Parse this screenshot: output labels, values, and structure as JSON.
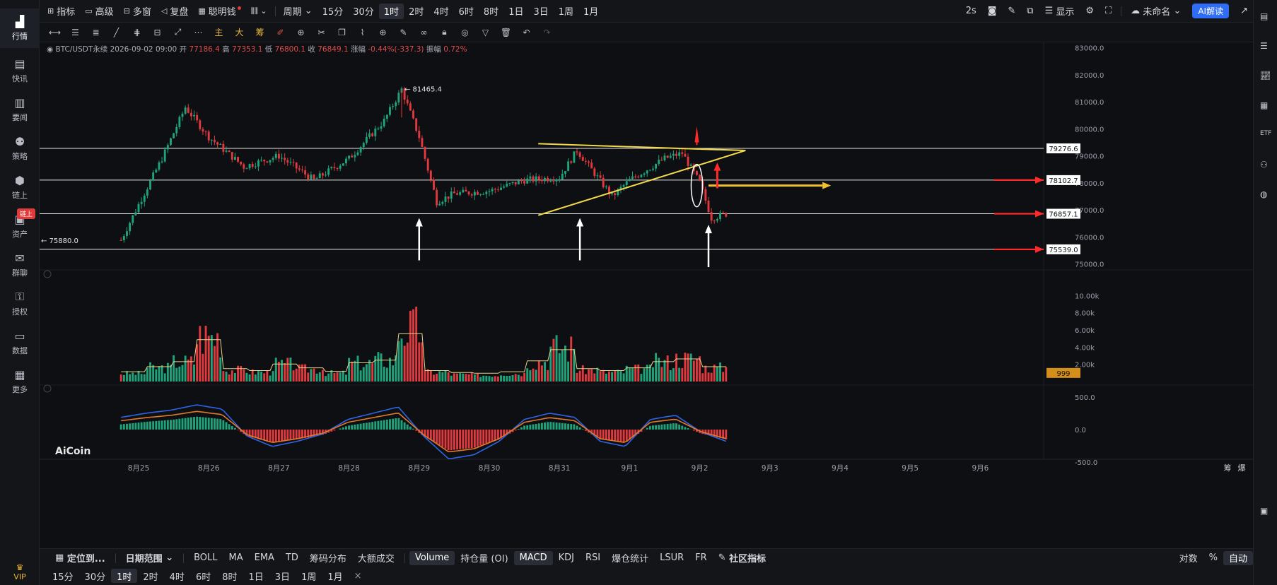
{
  "nav": [
    {
      "label": "行情",
      "icon": "market-icon",
      "active": true
    },
    {
      "label": "快讯",
      "icon": "news-flash-icon"
    },
    {
      "label": "要闻",
      "icon": "headlines-icon"
    },
    {
      "label": "策略",
      "icon": "strategy-robot-icon"
    },
    {
      "label": "链上",
      "icon": "onchain-icon"
    },
    {
      "label": "资产",
      "icon": "wallet-icon",
      "badge": "链上"
    },
    {
      "label": "群聊",
      "icon": "chat-icon"
    },
    {
      "label": "授权",
      "icon": "authorize-icon"
    },
    {
      "label": "数据",
      "icon": "data-monitor-icon"
    },
    {
      "label": "更多",
      "icon": "more-grid-icon"
    }
  ],
  "vip_label": "VIP",
  "topbar": {
    "left": [
      "指标",
      "高级",
      "多窗",
      "复盘",
      "聪明钱"
    ],
    "period_label": "周期",
    "periods": [
      "15分",
      "30分",
      "1时",
      "2时",
      "4时",
      "6时",
      "8时",
      "1日",
      "3日",
      "1周",
      "1月"
    ],
    "active_period": "1时",
    "refresh": "2s",
    "display": "显示",
    "layout_name": "未命名",
    "ai_button": "AI解读"
  },
  "drawbar_text": [
    "主",
    "大",
    "筹"
  ],
  "infobar": {
    "symbol": "BTC/USDT永续",
    "datetime": "2026-09-02 09:00",
    "open_label": "开",
    "open": "77186.4",
    "high_label": "高",
    "high": "77353.1",
    "low_label": "低",
    "low": "76800.1",
    "close_label": "收",
    "close": "76849.1",
    "change_label": "涨幅",
    "change": "-0.44%(-337.3)",
    "amp_label": "振幅",
    "amp": "0.72%"
  },
  "watermark": "AiCoin",
  "price_axis": [
    "83000.0",
    "82000.0",
    "81000.0",
    "80000.0",
    "79000.0",
    "78000.0",
    "77000.0",
    "76000.0",
    "75000.0"
  ],
  "h_levels": [
    {
      "value": "79276.6",
      "price": 79276.6
    },
    {
      "value": "78102.7",
      "price": 78102.7
    },
    {
      "value": "76857.1",
      "price": 76857.1
    },
    {
      "value": "75539.0",
      "price": 75539.0
    }
  ],
  "high_marker": "81465.4",
  "low_marker": "75880.0",
  "volume_axis": [
    "10.00k",
    "8.00k",
    "6.00k",
    "4.00k",
    "2.00k"
  ],
  "volume_last": "999",
  "macd_axis": [
    "500.0",
    "0.0",
    "-500.0"
  ],
  "date_axis": [
    "8月25",
    "8月26",
    "8月27",
    "8月28",
    "8月29",
    "8月30",
    "8月31",
    "9月1",
    "9月2",
    "9月3",
    "9月4",
    "9月5",
    "9月6"
  ],
  "axis_corner": [
    "筹",
    "爆"
  ],
  "bottom1": {
    "locate": "定位到...",
    "range": "日期范围",
    "indicators": [
      "BOLL",
      "MA",
      "EMA",
      "TD",
      "筹码分布",
      "大额成交",
      "Volume",
      "持仓量 (OI)",
      "MACD",
      "KDJ",
      "RSI",
      "爆仓统计",
      "LSUR",
      "FR"
    ],
    "active_indicators": [
      "Volume",
      "MACD"
    ],
    "community": "社区指标",
    "log": "对数",
    "pct": "%",
    "auto": "自动"
  },
  "bottom2": [
    "15分",
    "30分",
    "1时",
    "2时",
    "4时",
    "6时",
    "8时",
    "1日",
    "3日",
    "1周",
    "1月"
  ],
  "bottom2_active": "1时",
  "colors": {
    "up": "#1fa37a",
    "down": "#e0393e",
    "annot_red": "#ff2a2a",
    "annot_yellow": "#f2d94a",
    "bg": "#0e0f12"
  },
  "chart_data": {
    "type": "candlestick",
    "symbol": "BTC/USDT永续",
    "interval": "1时",
    "ylim": [
      74700,
      83200
    ],
    "close_series": [
      {
        "x": "8月24 18:00",
        "y": 75880
      },
      {
        "x": "8月25 00:00",
        "y": 77200
      },
      {
        "x": "8月25 08:00",
        "y": 78900
      },
      {
        "x": "8月25 16:00",
        "y": 80800
      },
      {
        "x": "8月26 00:00",
        "y": 79700
      },
      {
        "x": "8月26 12:00",
        "y": 78600
      },
      {
        "x": "8月27 00:00",
        "y": 79000
      },
      {
        "x": "8月27 12:00",
        "y": 78100
      },
      {
        "x": "8月28 00:00",
        "y": 78900
      },
      {
        "x": "8月28 12:00",
        "y": 80300
      },
      {
        "x": "8月28 18:00",
        "y": 81465.4
      },
      {
        "x": "8月29 00:00",
        "y": 79700
      },
      {
        "x": "8月29 06:00",
        "y": 77300
      },
      {
        "x": "8月29 12:00",
        "y": 77600
      },
      {
        "x": "8月30 00:00",
        "y": 77700
      },
      {
        "x": "8月30 12:00",
        "y": 78100
      },
      {
        "x": "8月31 00:00",
        "y": 78200
      },
      {
        "x": "8月31 06:00",
        "y": 79200
      },
      {
        "x": "8月31 18:00",
        "y": 77500
      },
      {
        "x": "9月1 00:00",
        "y": 78100
      },
      {
        "x": "9月1 12:00",
        "y": 78900
      },
      {
        "x": "9月1 18:00",
        "y": 79100
      },
      {
        "x": "9月2 00:00",
        "y": 78000
      },
      {
        "x": "9月2 04:00",
        "y": 76700
      },
      {
        "x": "9月2 09:00",
        "y": 76849.1
      }
    ],
    "volume_series_k": [
      1.2,
      2.5,
      3.8,
      9.5,
      2.0,
      1.5,
      3.2,
      2.2,
      1.3,
      3.5,
      4.2,
      11.0,
      1.5,
      1.0,
      0.8,
      1.2,
      4.0,
      6.9,
      2.0,
      1.5,
      2.2,
      3.8,
      4.5,
      2.5,
      1.0
    ],
    "macd_hist": [
      80,
      120,
      150,
      200,
      160,
      -100,
      -200,
      -150,
      -80,
      60,
      120,
      180,
      -100,
      -320,
      -280,
      -150,
      60,
      120,
      80,
      -150,
      -200,
      60,
      100,
      -60,
      -150
    ]
  }
}
